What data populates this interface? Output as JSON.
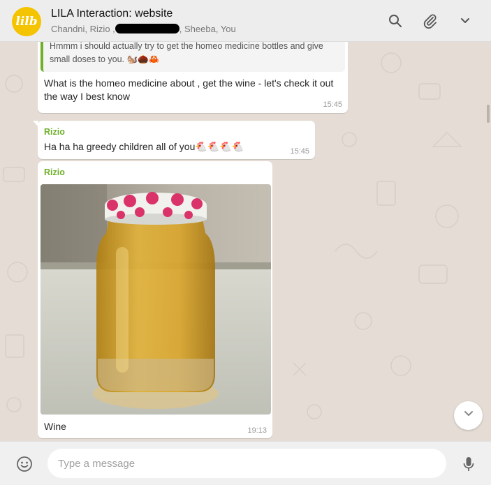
{
  "header": {
    "avatar_text": "lilb",
    "title": "LILA Interaction: website",
    "participants_before": "Chandni, Rizio ,",
    "participants_after": ", Sheeba, You",
    "icons": [
      "search-icon",
      "attach-icon",
      "menu-chevron-icon"
    ]
  },
  "messages": [
    {
      "quoted_text": "Hmmm i should actually try to get the homeo medicine bottles and give small doses to you. 🐿️🌰🦀",
      "text": "What is the homeo medicine about , get the wine - let's check it out the way I best know",
      "time": "15:45"
    },
    {
      "sender": "Rizio",
      "text": "Ha ha ha greedy children all of you🐔🐔🐔🐔",
      "time": "15:45"
    },
    {
      "sender": "Rizio",
      "caption": "Wine",
      "time": "19:13",
      "image": "jar-of-wine-photo"
    }
  ],
  "composer": {
    "placeholder": "Type a message",
    "icons": [
      "emoji-icon",
      "microphone-icon"
    ]
  },
  "colors": {
    "sender": "#6fb02a",
    "avatar": "#f5c400",
    "chat_background": "#e5ddd5"
  }
}
